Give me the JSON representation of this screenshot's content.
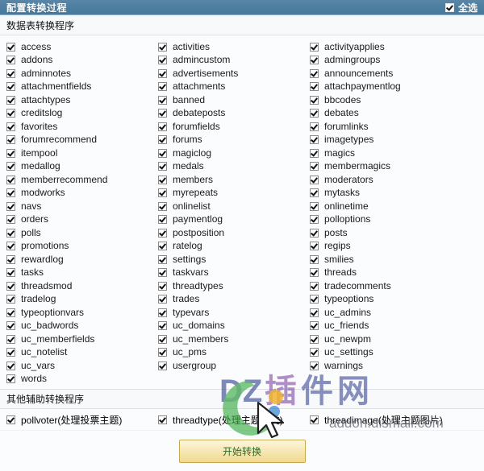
{
  "titlebar": {
    "title": "配置转换过程",
    "select_all_label": "全选",
    "select_all_checked": true,
    "bg_color": "#4d7ea0"
  },
  "sections": {
    "tables_heading": "数据表转换程序",
    "aux_heading": "其他辅助转换程序"
  },
  "tables": {
    "columns": 3,
    "col1": [
      "access",
      "addons",
      "adminnotes",
      "attachmentfields",
      "attachtypes",
      "creditslog",
      "favorites",
      "forumrecommend",
      "itempool",
      "medallog",
      "memberrecommend",
      "modworks",
      "navs",
      "orders",
      "polls",
      "promotions",
      "rewardlog",
      "tasks",
      "threadsmod",
      "tradelog",
      "typeoptionvars",
      "uc_badwords",
      "uc_memberfields",
      "uc_notelist",
      "uc_vars",
      "words"
    ],
    "col2": [
      "activities",
      "admincustom",
      "advertisements",
      "attachments",
      "banned",
      "debateposts",
      "forumfields",
      "forums",
      "magiclog",
      "medals",
      "members",
      "myrepeats",
      "onlinelist",
      "paymentlog",
      "postposition",
      "ratelog",
      "settings",
      "taskvars",
      "threadtypes",
      "trades",
      "typevars",
      "uc_domains",
      "uc_members",
      "uc_pms",
      "usergroup",
      ""
    ],
    "col3": [
      "activityapplies",
      "admingroups",
      "announcements",
      "attachpaymentlog",
      "bbcodes",
      "debates",
      "forumlinks",
      "imagetypes",
      "magics",
      "membermagics",
      "moderators",
      "mytasks",
      "onlinetime",
      "polloptions",
      "posts",
      "regips",
      "smilies",
      "threads",
      "tradecomments",
      "typeoptions",
      "uc_admins",
      "uc_friends",
      "uc_newpm",
      "uc_settings",
      "warnings",
      ""
    ]
  },
  "aux": {
    "items": [
      "pollvoter(处理投票主题)",
      "threadtype(处理主题分类)",
      "threadimage(处理主题图片)"
    ]
  },
  "submit": {
    "label": "开始转换"
  },
  "watermark": {
    "brand": "DZ插件网",
    "site": "addon.dismall.com"
  }
}
